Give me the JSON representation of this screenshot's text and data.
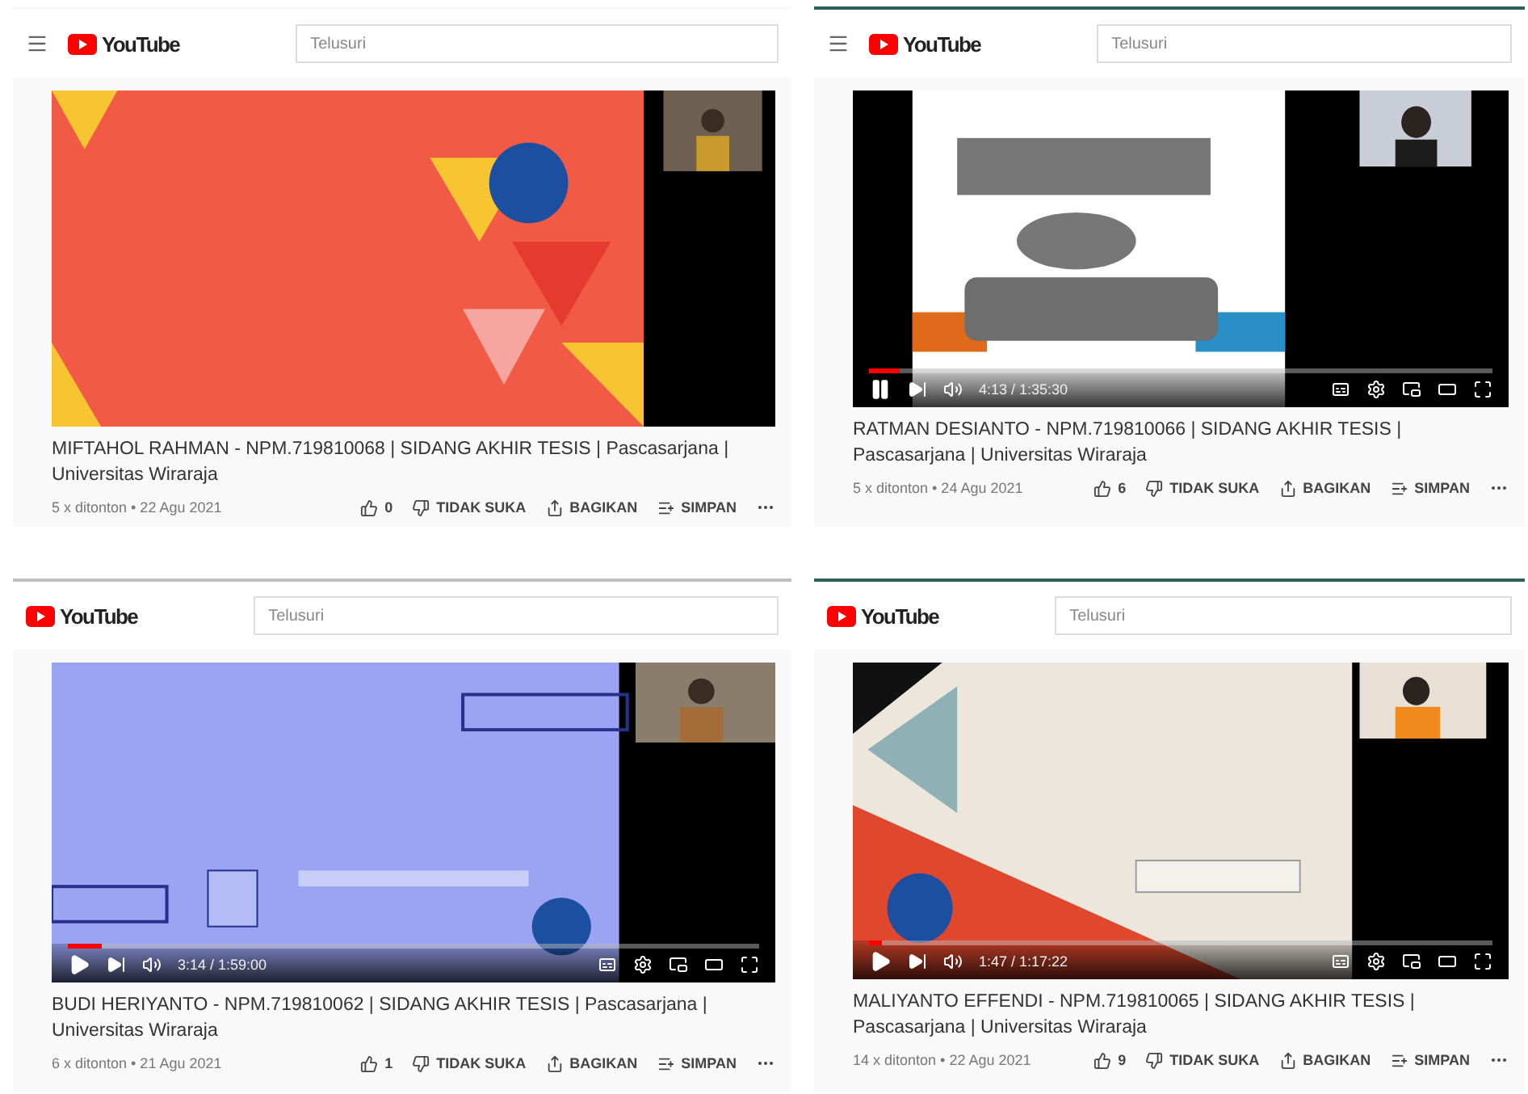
{
  "panels": [
    {
      "header": {
        "menu_button": true,
        "logo": "YouTube",
        "search_placeholder": "Telusuri"
      },
      "title": "MIFTAHOL RAHMAN - NPM.719810068 | SIDANG AKHIR TESIS | Pascasarjana | Universitas Wiraraja",
      "meta": "5 x ditonton • 22 Agu 2021",
      "actions": {
        "likes": "0",
        "dislike": "TIDAK SUKA",
        "share": "BAGIKAN",
        "save": "SIMPAN"
      }
    },
    {
      "header": {
        "menu_button": true,
        "logo": "YouTube",
        "search_placeholder": "Telusuri"
      },
      "video": {
        "controls": {
          "playing": true,
          "level": 0.05,
          "time": "4:13 / 1:35:30"
        }
      },
      "title": "RATMAN DESIANTO - NPM.719810066 | SIDANG AKHIR TESIS | Pascasarjana | Universitas Wiraraja",
      "meta": "5 x ditonton • 24 Agu 2021",
      "actions": {
        "likes": "6",
        "dislike": "TIDAK SUKA",
        "share": "BAGIKAN",
        "save": "SIMPAN"
      }
    },
    {
      "header": {
        "menu_button": false,
        "logo": "YouTube",
        "search_placeholder": "Telusuri"
      },
      "video": {
        "controls": {
          "playing": false,
          "level": 0.05,
          "time": "3:14 / 1:59:00"
        }
      },
      "title": "BUDI HERIYANTO - NPM.719810062 | SIDANG AKHIR TESIS | Pascasarjana | Universitas Wiraraja",
      "meta": "6 x ditonton • 21 Agu 2021",
      "actions": {
        "likes": "1",
        "dislike": "TIDAK SUKA",
        "share": "BAGIKAN",
        "save": "SIMPAN"
      }
    },
    {
      "header": {
        "menu_button": false,
        "logo": "YouTube",
        "search_placeholder": "Telusuri"
      },
      "video": {
        "controls": {
          "playing": false,
          "level": 0.02,
          "time": "1:47 / 1:17:22"
        }
      },
      "title": "MALIYANTO EFFENDI - NPM.719810065 | SIDANG AKHIR TESIS | Pascasarjana | Universitas Wiraraja",
      "meta": "14 x ditonton • 22 Agu 2021",
      "actions": {
        "likes": "9",
        "dislike": "TIDAK SUKA",
        "share": "BAGIKAN",
        "save": "SIMPAN"
      }
    }
  ]
}
